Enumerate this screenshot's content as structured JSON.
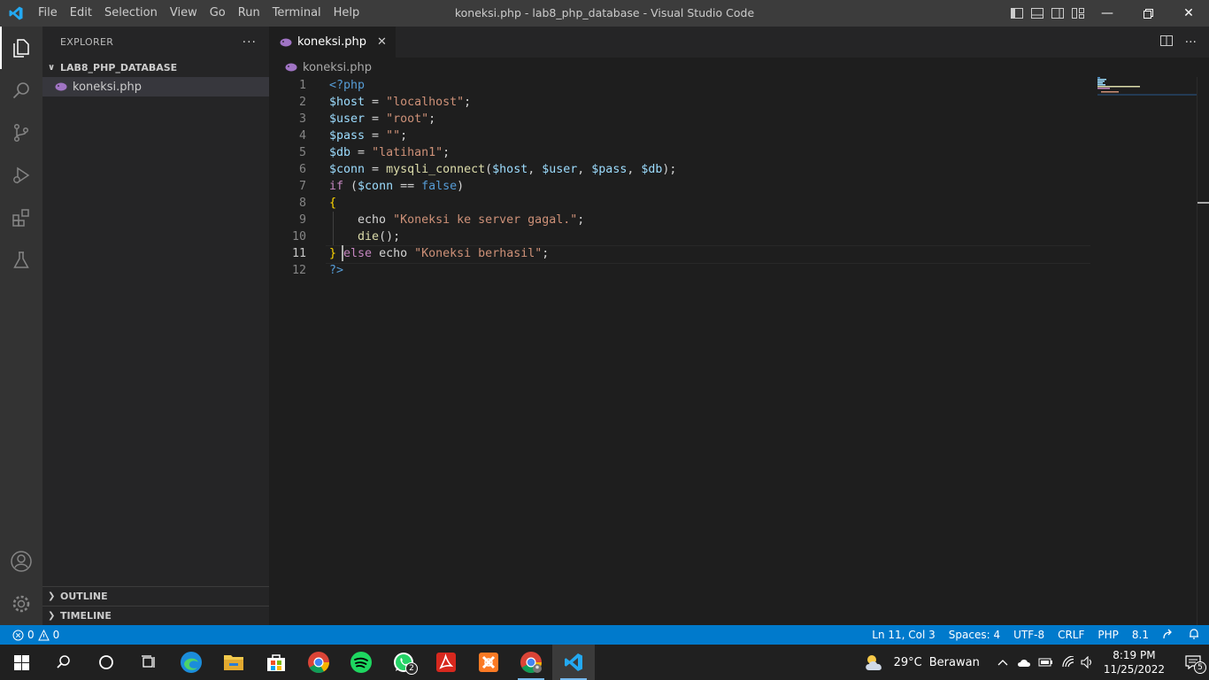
{
  "window": {
    "title": "koneksi.php - lab8_php_database - Visual Studio Code",
    "menu": [
      "File",
      "Edit",
      "Selection",
      "View",
      "Go",
      "Run",
      "Terminal",
      "Help"
    ]
  },
  "sidebar": {
    "title": "EXPLORER",
    "more": "···",
    "folder": "LAB8_PHP_DATABASE",
    "files": [
      {
        "name": "koneksi.php"
      }
    ],
    "bottom_sections": [
      "OUTLINE",
      "TIMELINE"
    ]
  },
  "editor": {
    "tab_label": "koneksi.php",
    "breadcrumb": "koneksi.php",
    "current_line": 11,
    "line_numbers": [
      "1",
      "2",
      "3",
      "4",
      "5",
      "6",
      "7",
      "8",
      "9",
      "10",
      "11",
      "12"
    ],
    "code_lines": [
      "<?php",
      "$host = \"localhost\";",
      "$user = \"root\";",
      "$pass = \"\";",
      "$db = \"latihan1\";",
      "$conn = mysqli_connect($host, $user, $pass, $db);",
      "if ($conn == false)",
      "{",
      "    echo \"Koneksi ke server gagal.\";",
      "    die();",
      "} else echo \"Koneksi berhasil\";",
      "?>"
    ]
  },
  "statusbar": {
    "errors": "0",
    "warnings": "0",
    "position": "Ln 11, Col 3",
    "spaces": "Spaces: 4",
    "encoding": "UTF-8",
    "eol": "CRLF",
    "language": "PHP",
    "version": "8.1"
  },
  "taskbar": {
    "weather_temp": "29°C",
    "weather_text": "Berawan",
    "time": "8:19 PM",
    "date": "11/25/2022",
    "whatsapp_badge": "2",
    "notification_count": "5"
  },
  "colors": {
    "accent": "#007acc",
    "titlebar": "#3c3c3c",
    "activitybar": "#333333",
    "sidebar": "#252526",
    "editor_bg": "#1e1e1e"
  }
}
